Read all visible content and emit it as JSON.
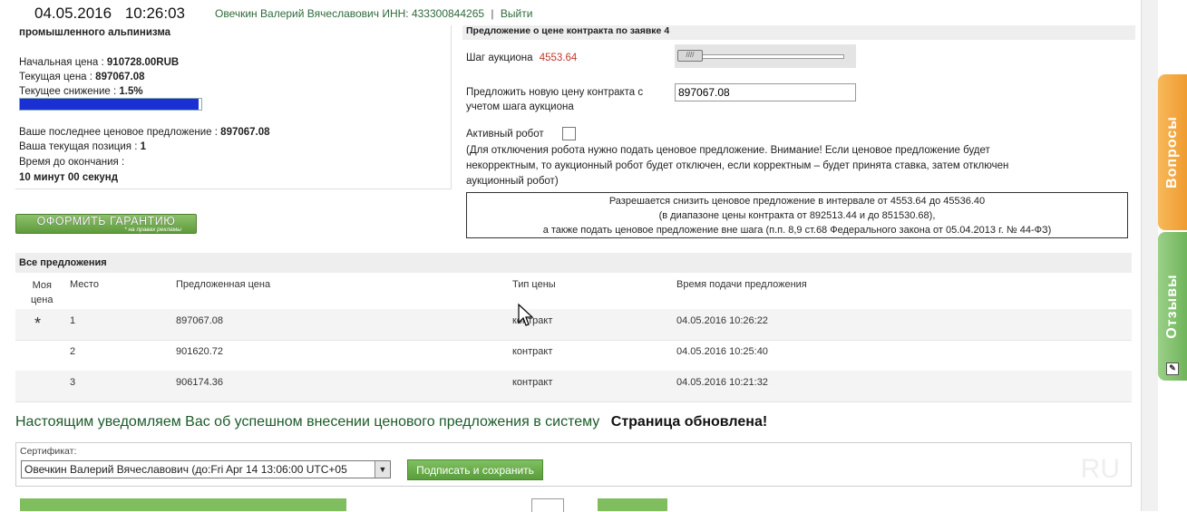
{
  "header": {
    "date": "04.05.2016",
    "time": "10:26:03",
    "user": "Овечкин Валерий Вячеславович ИНН: 433300844265",
    "separator": "|",
    "logout": "Выйти"
  },
  "lot": {
    "title_fragment": "промышленного альпинизма",
    "start_price_label": "Начальная цена :",
    "start_price": "910728.00RUB",
    "current_price_label": "Текущая цена :",
    "current_price": "897067.08",
    "decrease_label": "Текущее снижение :",
    "decrease": "1.5%",
    "decrease_progress": 0.985,
    "last_offer_label": "Ваше последнее ценовое предложение :",
    "last_offer": "897067.08",
    "position_label": "Ваша текущая позиция :",
    "position": "1",
    "time_left_label": "Время до окончания :",
    "time_left": "10 минут 00 секунд"
  },
  "guarantee_button": {
    "label": "ОФОРМИТЬ ГАРАНТИЮ",
    "sub": "* на правах рекламы"
  },
  "offer": {
    "header": "Предложение о цене контракта по заявке",
    "bid_number": "4",
    "step_label": "Шаг аукциона",
    "step_value": "4553.64",
    "new_price_label_1": "Предложить новую цену контракта с",
    "new_price_label_2": "учетом шага аукциона",
    "new_price_value": "897067.08",
    "robot_label": "Активный робот",
    "robot_note_1": "(Для отключения робота нужно подать ценовое предложение. Внимание! Если ценовое предложение будет",
    "robot_note_2": "некорректным, то аукционный робот будет отключен, если корректным – будет принята ставка, затем отключен",
    "robot_note_3": "аукционный робот)",
    "interval_1": "Разрешается снизить ценовое предложение в интервале  от 4553.64  до 45536.40",
    "interval_2": "(в диапазоне цены контракта от 892513.44 и  до 851530.68),",
    "interval_3": "а также подать ценовое предложение вне шага (п.п. 8,9 ст.68 Федерального закона от 05.04.2013 г. № 44-ФЗ)"
  },
  "bids": {
    "title": "Все предложения",
    "columns": {
      "mine_1": "Моя",
      "mine_2": "цена",
      "place": "Место",
      "price": "Предложенная цена",
      "type": "Тип цены",
      "time": "Время подачи предложения"
    },
    "rows": [
      {
        "mine": "*",
        "place": "1",
        "price": "897067.08",
        "type": "контракт",
        "time": "04.05.2016 10:26:22"
      },
      {
        "mine": "",
        "place": "2",
        "price": "901620.72",
        "type": "контракт",
        "time": "04.05.2016 10:25:40"
      },
      {
        "mine": "",
        "place": "3",
        "price": "906174.36",
        "type": "контракт",
        "time": "04.05.2016 10:21:32"
      }
    ]
  },
  "notice": {
    "message": "Настоящим уведомляем Вас об успешном внесении ценового предложения в систему",
    "status": "Страница обновлена!"
  },
  "certificate": {
    "label": "Сертификат:",
    "selected": "Овечкин Валерий Вячеславович (до:Fri Apr 14 13:06:00 UTC+05",
    "sign_button": "Подписать и сохранить",
    "watermark": "RU"
  },
  "side_tabs": {
    "questions": "Вопросы",
    "reviews": "Отзывы"
  },
  "colors": {
    "accent_green": "#2e6b3a",
    "progress_blue": "#1a2fd4",
    "step_red": "#c0392b",
    "tab_orange": "#ef9b30",
    "tab_green": "#6fb45a"
  }
}
